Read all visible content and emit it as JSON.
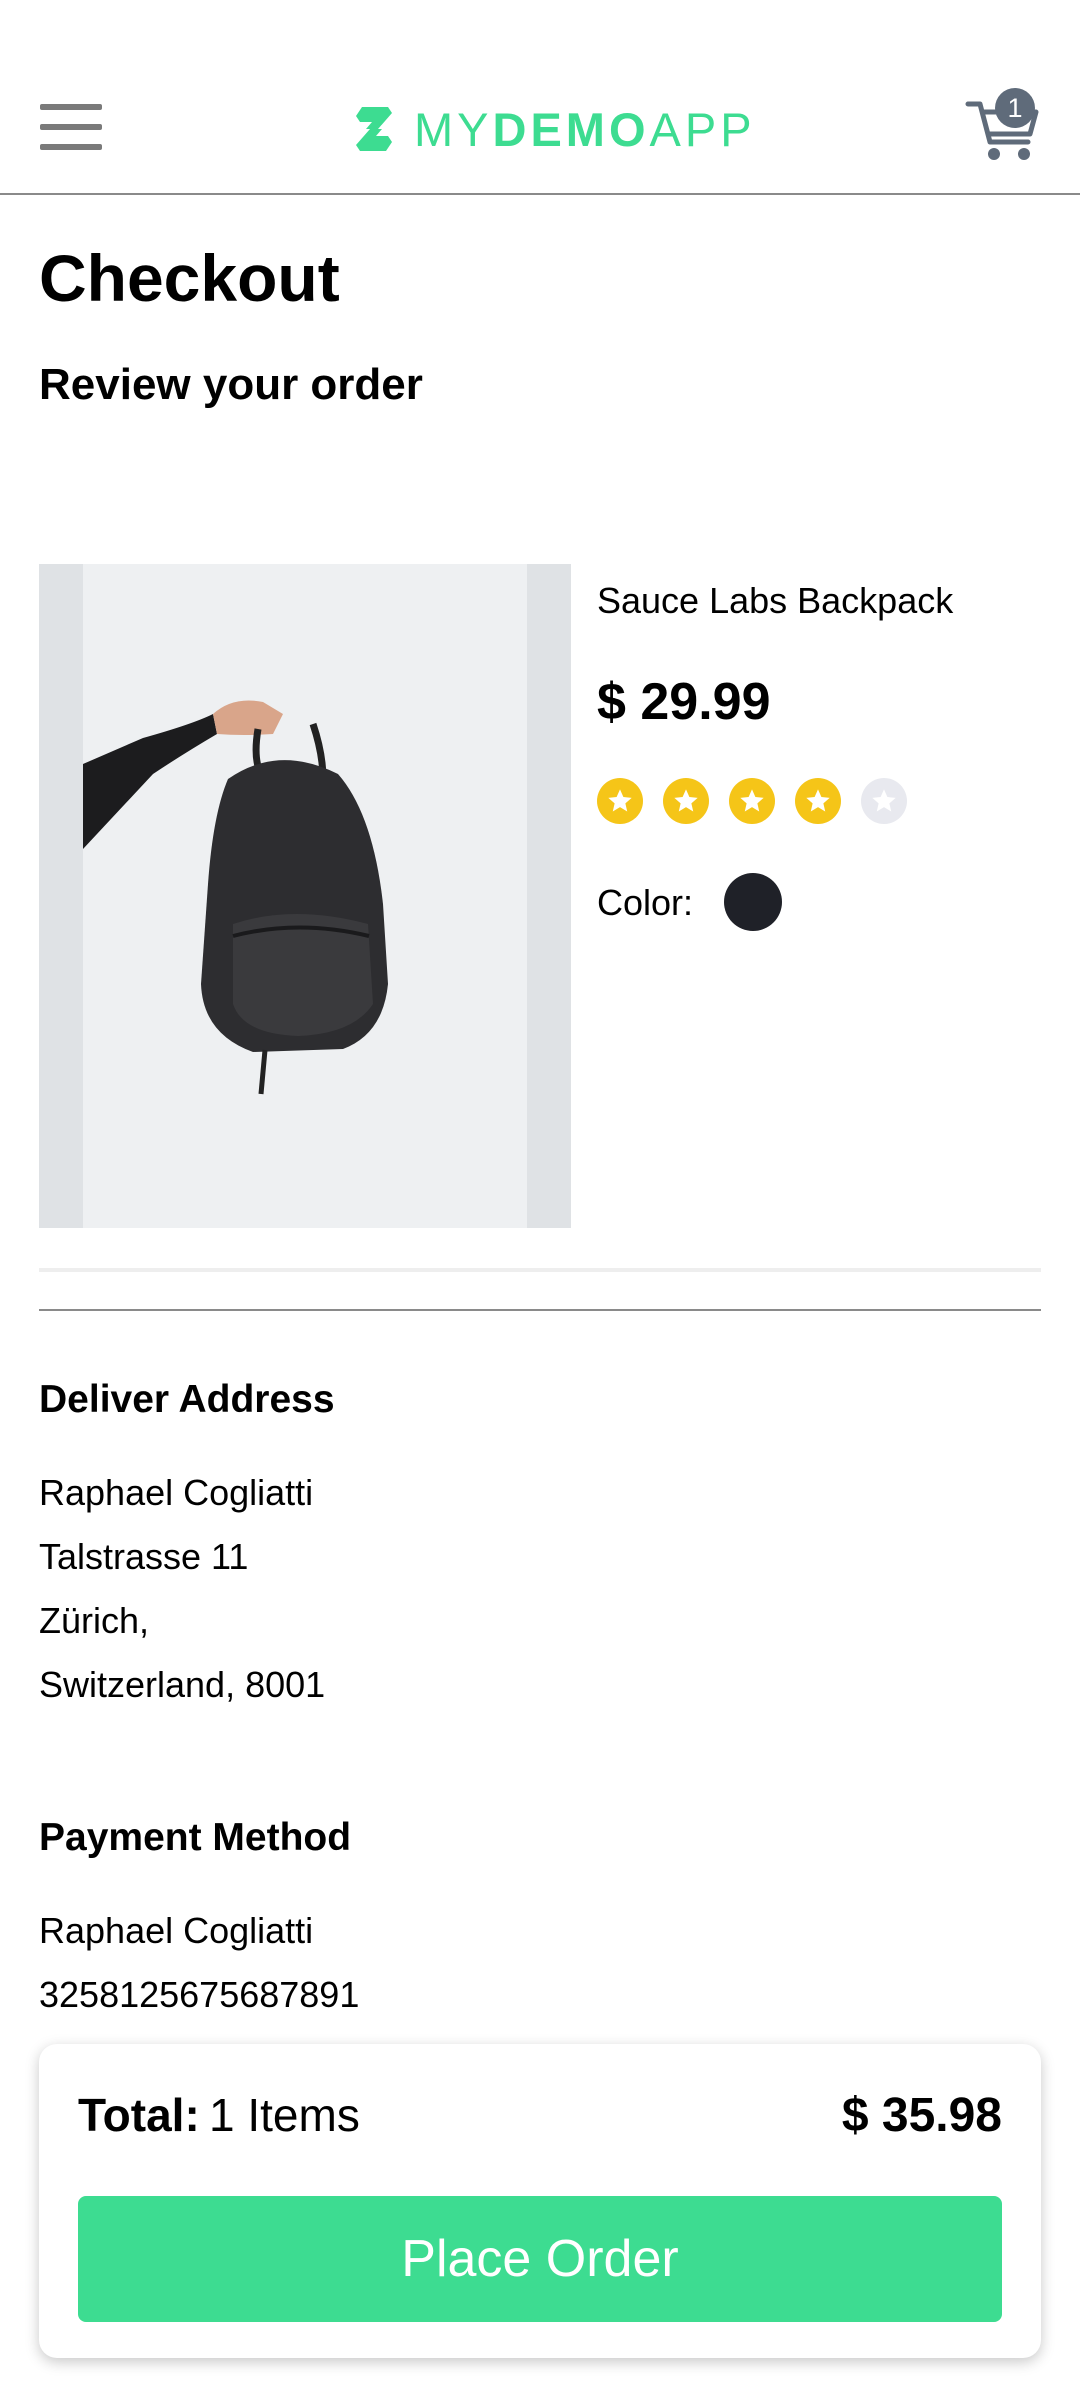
{
  "header": {
    "logo_text_my": "MY",
    "logo_text_demo": "DEMO",
    "logo_text_app": "APP",
    "cart_count": "1",
    "brand_color": "#3ddc91"
  },
  "page": {
    "title": "Checkout",
    "subtitle": "Review your order"
  },
  "product": {
    "name": "Sauce Labs Backpack",
    "price": "$ 29.99",
    "rating": 4,
    "rating_max": 5,
    "color_label": "Color:",
    "color_value": "#1f2128"
  },
  "delivery": {
    "heading": "Deliver Address",
    "name": "Raphael Cogliatti",
    "street": "Talstrasse 11",
    "city": "Zürich,",
    "country_zip": "Switzerland, 8001"
  },
  "payment": {
    "heading": "Payment Method",
    "name": "Raphael Cogliatti",
    "card_number": "3258125675687891"
  },
  "footer": {
    "total_label": "Total:",
    "total_items": "1 Items",
    "total_price": "$ 35.98",
    "place_order_label": "Place Order"
  }
}
